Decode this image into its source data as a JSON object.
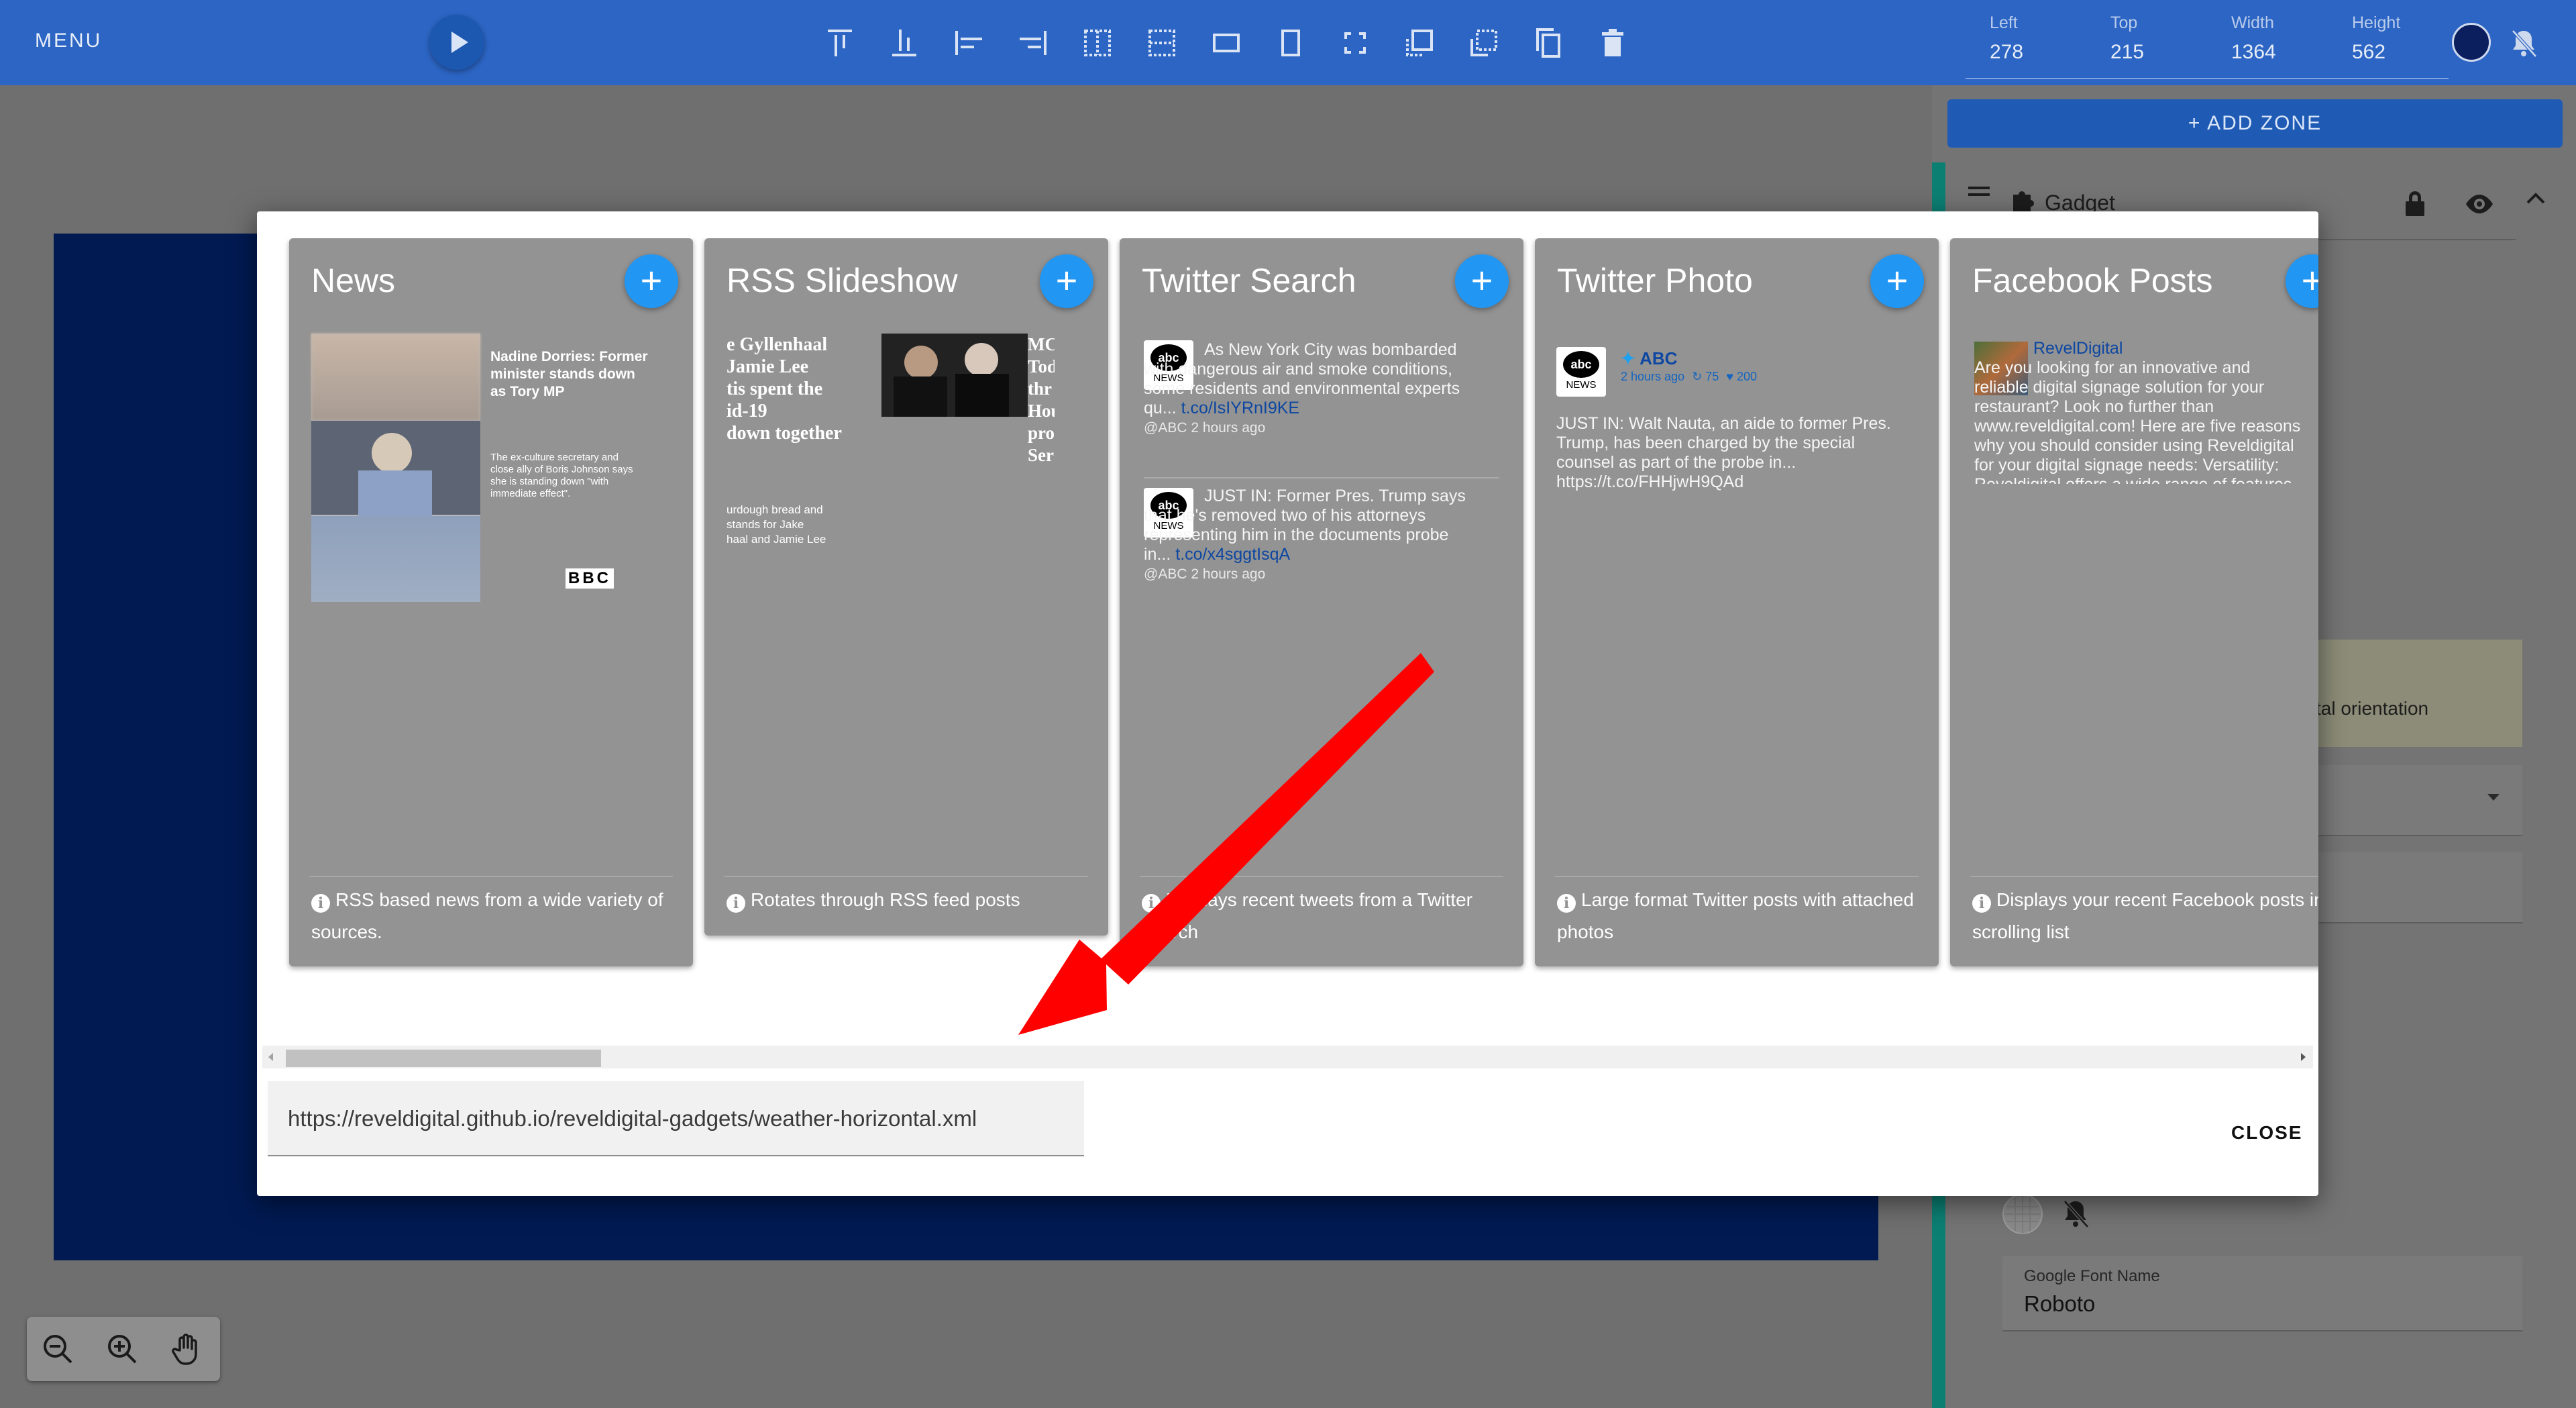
{
  "toolbar": {
    "menu_label": "MENU",
    "play_icon": "play-icon",
    "tool_icons": [
      "align-top-icon",
      "align-bottom-icon",
      "align-left-icon",
      "align-right-icon",
      "distribute-horizontal-icon",
      "distribute-vertical-icon",
      "fit-width-icon",
      "fit-height-icon",
      "fullscreen-icon",
      "bring-forward-icon",
      "send-backward-icon",
      "copy-icon",
      "delete-icon"
    ],
    "coords": [
      {
        "label": "Left",
        "value": "278"
      },
      {
        "label": "Top",
        "value": "215"
      },
      {
        "label": "Width",
        "value": "1364"
      },
      {
        "label": "Height",
        "value": "562"
      }
    ],
    "accent_color": "#2c65c4",
    "selected_color": "#0b1f5e"
  },
  "panel": {
    "add_zone_label": "+ ADD ZONE",
    "gadget_label": "Gadget",
    "orientation_text": "tal orientation",
    "google_font_label": "Google Font Name",
    "google_font_value": "Roboto"
  },
  "modal": {
    "cards": [
      {
        "title": "News",
        "description": "RSS based news from a wide variety of sources.",
        "preview": {
          "headline": "Nadine Dorries: Former minister stands down as Tory MP",
          "summary": "The ex-culture secretary and close ally of Boris Johnson says she is standing down \"with immediate effect\".",
          "source": "BBC"
        }
      },
      {
        "title": "RSS Slideshow",
        "description": "Rotates through RSS feed posts",
        "preview": {
          "headline_lines": [
            "e Gyllenhaal",
            "Jamie Lee",
            "tis spent the",
            "id-19",
            "down together"
          ],
          "summary_lines": [
            "urdough bread and",
            "stands for Jake",
            "haal and Jamie Lee"
          ],
          "right_lines": [
            "MC",
            "Tod",
            "thr",
            "Hou",
            "pro",
            "Ser"
          ]
        }
      },
      {
        "title": "Twitter Search",
        "description": "Displays recent tweets from a Twitter search",
        "description_visible": "plays recent tweets from a Twitter search",
        "tweets": [
          {
            "text": "As New York City was bombarded with dangerous air and smoke conditions, some residents and environmental experts qu...",
            "link": "t.co/IsIYRnI9KE",
            "meta": "@ABC 2 hours ago"
          },
          {
            "text": "JUST IN: Former Pres. Trump says that he's removed two of his attorneys representing him in the documents probe in...",
            "link": "t.co/x4sggtIsqA",
            "meta": "@ABC 2 hours ago"
          }
        ]
      },
      {
        "title": "Twitter Photo",
        "description": "Large format Twitter posts with attached photos",
        "preview": {
          "account": "ABC",
          "meta": "2 hours ago",
          "retweets": "75",
          "likes": "200",
          "text": "JUST IN: Walt Nauta, an aide to former Pres. Trump, has been charged by the special counsel as part of the probe in... https://t.co/FHHjwH9QAd"
        }
      },
      {
        "title": "Facebook Posts",
        "description": "Displays your recent Facebook posts in a scrolling list",
        "preview": {
          "page": "RevelDigital",
          "text": "Are you looking for an innovative and reliable digital signage solution for your restaurant? Look no further than www.reveldigital.com! Here are five reasons why you should consider using Reveldigital for your digital signage needs: Versatility: Reveldigital offers a wide range of features that allow you to create engaging and dynamic displays for any industry or application. Whether you need a simple slideshow or a complex interactive experience"
        }
      }
    ],
    "add_button_label": "+",
    "info_icon_label": "i",
    "url_value": "https://reveldigital.github.io/reveldigital-gadgets/weather-horizontal.xml",
    "close_label": "CLOSE"
  }
}
